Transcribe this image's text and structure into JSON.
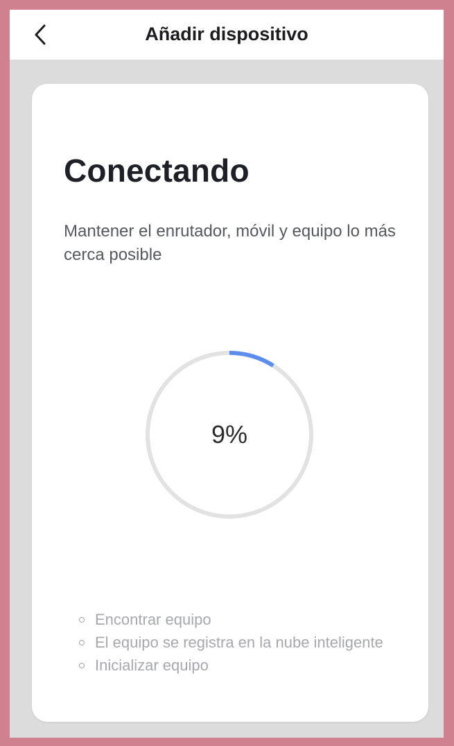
{
  "header": {
    "title": "Añadir dispositivo",
    "back_icon": "chevron-left-icon"
  },
  "connecting": {
    "title": "Conectando",
    "subtitle": "Mantener el enrutador, móvil y equipo lo más cerca posible"
  },
  "progress": {
    "value": 9,
    "label": "9%",
    "color": "#5b8def",
    "track_color": "#e2e2e2"
  },
  "steps": [
    {
      "label": "Encontrar equipo"
    },
    {
      "label": "El equipo se registra en la nube inteligente"
    },
    {
      "label": "Inicializar equipo"
    }
  ]
}
